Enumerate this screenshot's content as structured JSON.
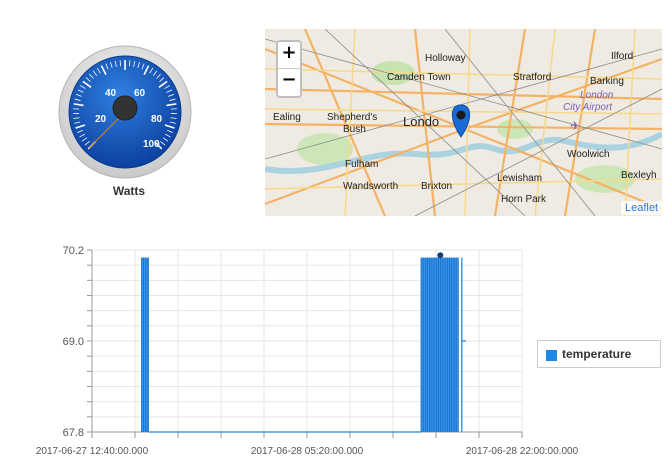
{
  "gauge": {
    "label": "Watts",
    "tick_labels": [
      "20",
      "40",
      "60",
      "80",
      "100"
    ],
    "value": 0
  },
  "map": {
    "zoom_in_label": "+",
    "zoom_out_label": "−",
    "attribution": "Leaflet",
    "place_labels": [
      "Holloway",
      "Camden Town",
      "Stratford",
      "Barking",
      "Ilford",
      "London",
      "City Airport",
      "Ealing",
      "Shepherd's",
      "Bush",
      "Londo",
      "Fulham",
      "Woolwich",
      "Lewisham",
      "Bexleyh",
      "Wandsworth",
      "Brixton",
      "Horn Park"
    ]
  },
  "chart_data": {
    "type": "line",
    "xlabel": "",
    "ylabel": "",
    "ylim": [
      67.8,
      70.2
    ],
    "y_ticks": [
      "70.2",
      "69.0",
      "67.8"
    ],
    "x_ticks": [
      "2017-06-27 12:40:00.000",
      "2017-06-28 05:20:00.000",
      "2017-06-28 22:00:00.000"
    ],
    "series": [
      {
        "name": "temperature",
        "color": "#1e88e5",
        "segments": [
          {
            "from": "2017-06-27 16:30:00",
            "to": "2017-06-27 17:05:00",
            "low": 67.8,
            "high": 70.1,
            "dense": true
          },
          {
            "from": "2017-06-27 17:05:00",
            "to": "2017-06-28 14:10:00",
            "value": 67.8
          },
          {
            "from": "2017-06-28 14:10:00",
            "to": "2017-06-28 17:05:00",
            "low": 67.8,
            "high": 70.1,
            "dense": true
          },
          {
            "from": "2017-06-28 17:20:00",
            "to": "2017-06-28 17:40:00",
            "low": 67.8,
            "high": 70.1,
            "dense": false
          }
        ],
        "marker": {
          "x": "2017-06-28 15:40:00",
          "y": 70.13
        }
      }
    ],
    "legend": "right",
    "grid": true
  }
}
